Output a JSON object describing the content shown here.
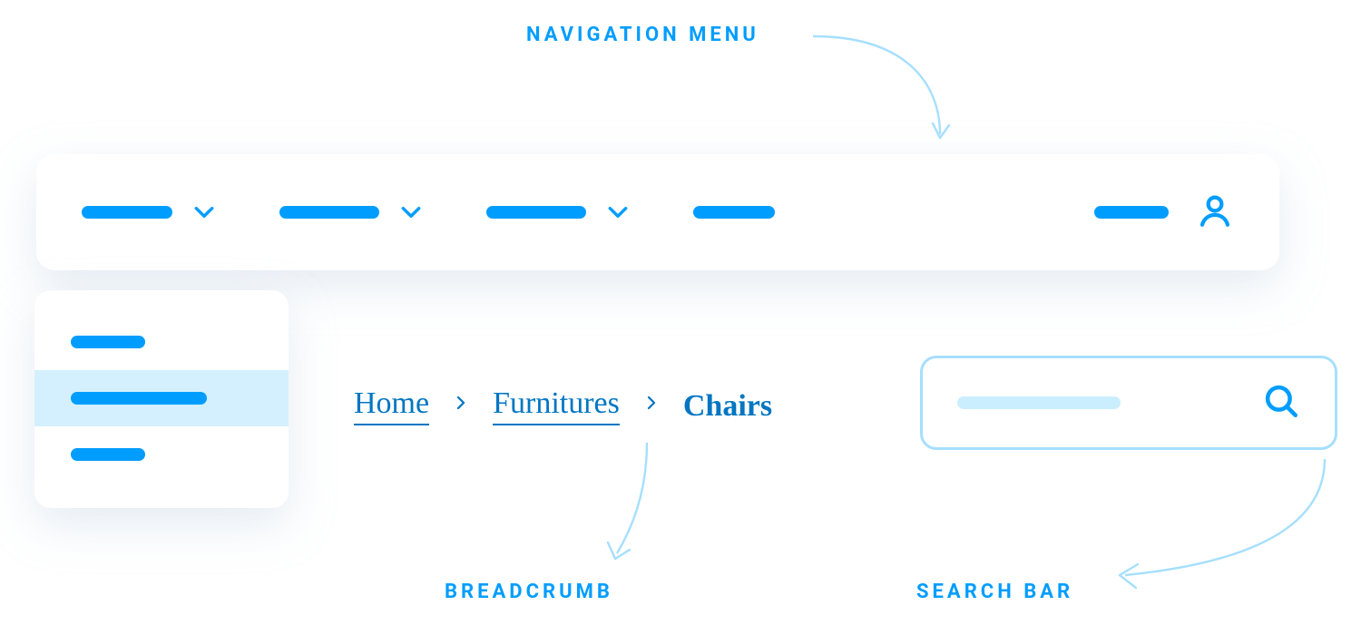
{
  "captions": {
    "navigation_menu": "NAVIGATION MENU",
    "breadcrumb": "BREADCRUMB",
    "search_bar": "SEARCH BAR"
  },
  "breadcrumb": {
    "items": [
      "Home",
      "Furnitures",
      "Chairs"
    ]
  },
  "colors": {
    "primary": "#009DFF",
    "link": "#0076C2",
    "pale": "#CBEEFF"
  }
}
